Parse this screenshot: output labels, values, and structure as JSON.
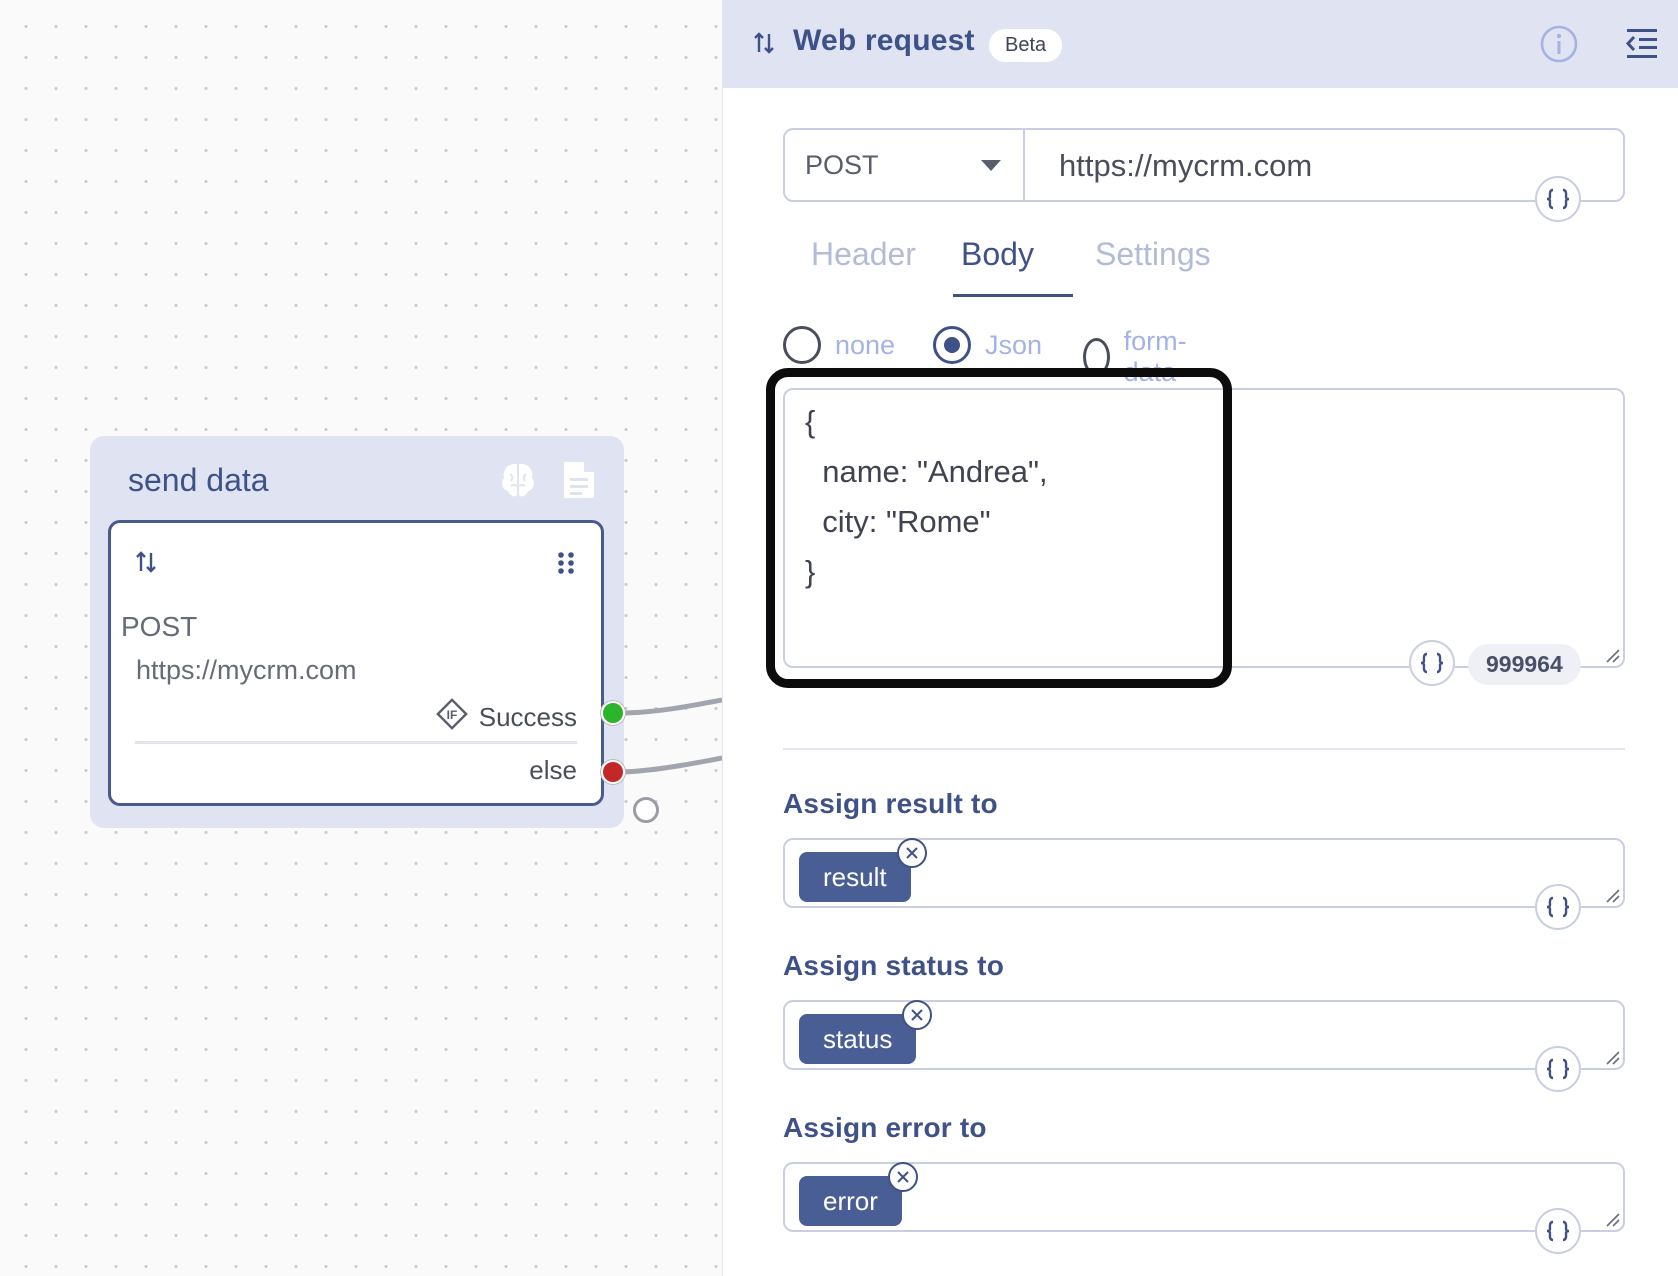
{
  "canvas": {
    "node": {
      "title": "send data",
      "icons": [
        "brain-icon",
        "document-icon"
      ],
      "card": {
        "icons": [
          "arrows-updown-icon",
          "drag-handle-icon"
        ],
        "method": "POST",
        "url": "https://mycrm.com",
        "success_label": "Success",
        "success_icon": "if-diamond-icon",
        "else_label": "else"
      }
    },
    "port_colors": {
      "success": "#2cb52c",
      "else": "#c32727"
    }
  },
  "panel": {
    "header": {
      "icon": "arrows-updown-icon",
      "title": "Web request",
      "badge": "Beta",
      "info_icon": "info-icon",
      "collapse_icon": "collapse-panel-icon"
    },
    "request": {
      "method": "POST",
      "url": "https://mycrm.com"
    },
    "tabs": [
      {
        "label": "Header",
        "active": false
      },
      {
        "label": "Body",
        "active": true
      },
      {
        "label": "Settings",
        "active": false
      }
    ],
    "body_types": [
      {
        "label": "none",
        "checked": false
      },
      {
        "label": "Json",
        "checked": true
      },
      {
        "label": "form-data",
        "checked": false
      }
    ],
    "body_code": [
      "{",
      "  name: \"Andrea\",",
      "  city: \"Rome\"",
      "}"
    ],
    "body_counter": "999964",
    "assign": [
      {
        "label": "Assign result to",
        "value": "result"
      },
      {
        "label": "Assign status to",
        "value": "status"
      },
      {
        "label": "Assign error to",
        "value": "error"
      }
    ]
  },
  "colors": {
    "accent": "#3f5287",
    "header_bg": "#dfe3f2",
    "chip_bg": "#4a5e96"
  }
}
